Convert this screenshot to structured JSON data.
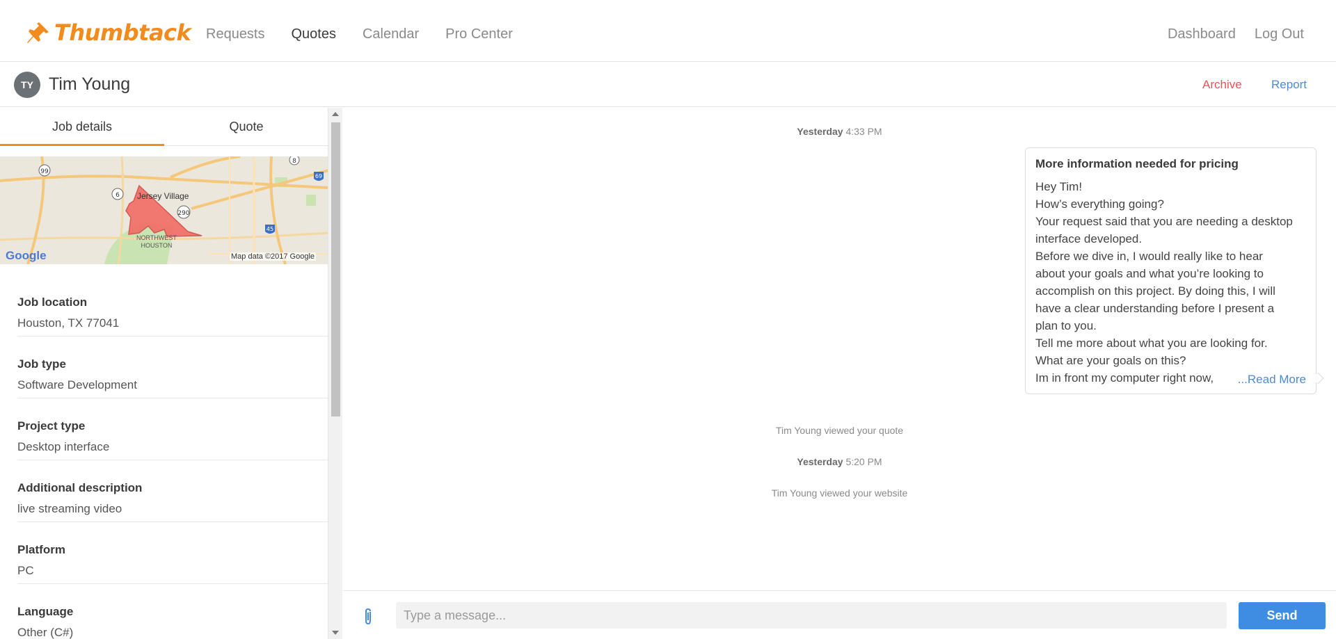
{
  "brand": {
    "name": "Thumbtack",
    "color": "#f28b1d"
  },
  "nav": {
    "left": [
      "Requests",
      "Quotes",
      "Calendar",
      "Pro Center"
    ],
    "active": "Quotes",
    "right": [
      "Dashboard",
      "Log Out"
    ]
  },
  "contact": {
    "initials": "TY",
    "name": "Tim Young",
    "archive_label": "Archive",
    "report_label": "Report"
  },
  "tabs": [
    "Job details",
    "Quote"
  ],
  "map": {
    "city_label": "Jersey Village",
    "area_label_1": "NORTHWEST",
    "area_label_2": "HOUSTON",
    "google_label": "Google",
    "copyright": "Map data ©2017 Google",
    "highways": [
      "99",
      "6",
      "290",
      "8",
      "69",
      "45"
    ]
  },
  "job_details": [
    {
      "label": "Job location",
      "value": "Houston, TX 77041"
    },
    {
      "label": "Job type",
      "value": "Software Development"
    },
    {
      "label": "Project type",
      "value": "Desktop interface"
    },
    {
      "label": "Additional description",
      "value": "live streaming video"
    },
    {
      "label": "Platform",
      "value": "PC"
    },
    {
      "label": "Language",
      "value": "Other (C#)"
    }
  ],
  "conversation": {
    "ts1_day": "Yesterday",
    "ts1_time": "4:33 PM",
    "message": {
      "title": "More information needed for pricing",
      "lines": [
        "Hey Tim!",
        "How’s everything going?",
        "Your request said that you are needing a desktop",
        "interface developed.",
        "Before we dive in, I would really like to hear",
        "about your goals and what you’re looking to",
        "accomplish on this project. By doing this, I will",
        "have a clear understanding before I present a",
        "plan to you.",
        "Tell me more about what you are looking for.",
        "What are your goals on this?",
        "Im in front my computer right now,"
      ],
      "read_more": "...Read More"
    },
    "event1": "Tim Young viewed your quote",
    "ts2_day": "Yesterday",
    "ts2_time": "5:20 PM",
    "event2": "Tim Young viewed your website"
  },
  "composer": {
    "placeholder": "Type a message...",
    "send_label": "Send"
  },
  "colors": {
    "accent": "#f28b1d",
    "link": "#4a8ad8",
    "danger": "#e0545a",
    "send": "#3f8de2"
  }
}
